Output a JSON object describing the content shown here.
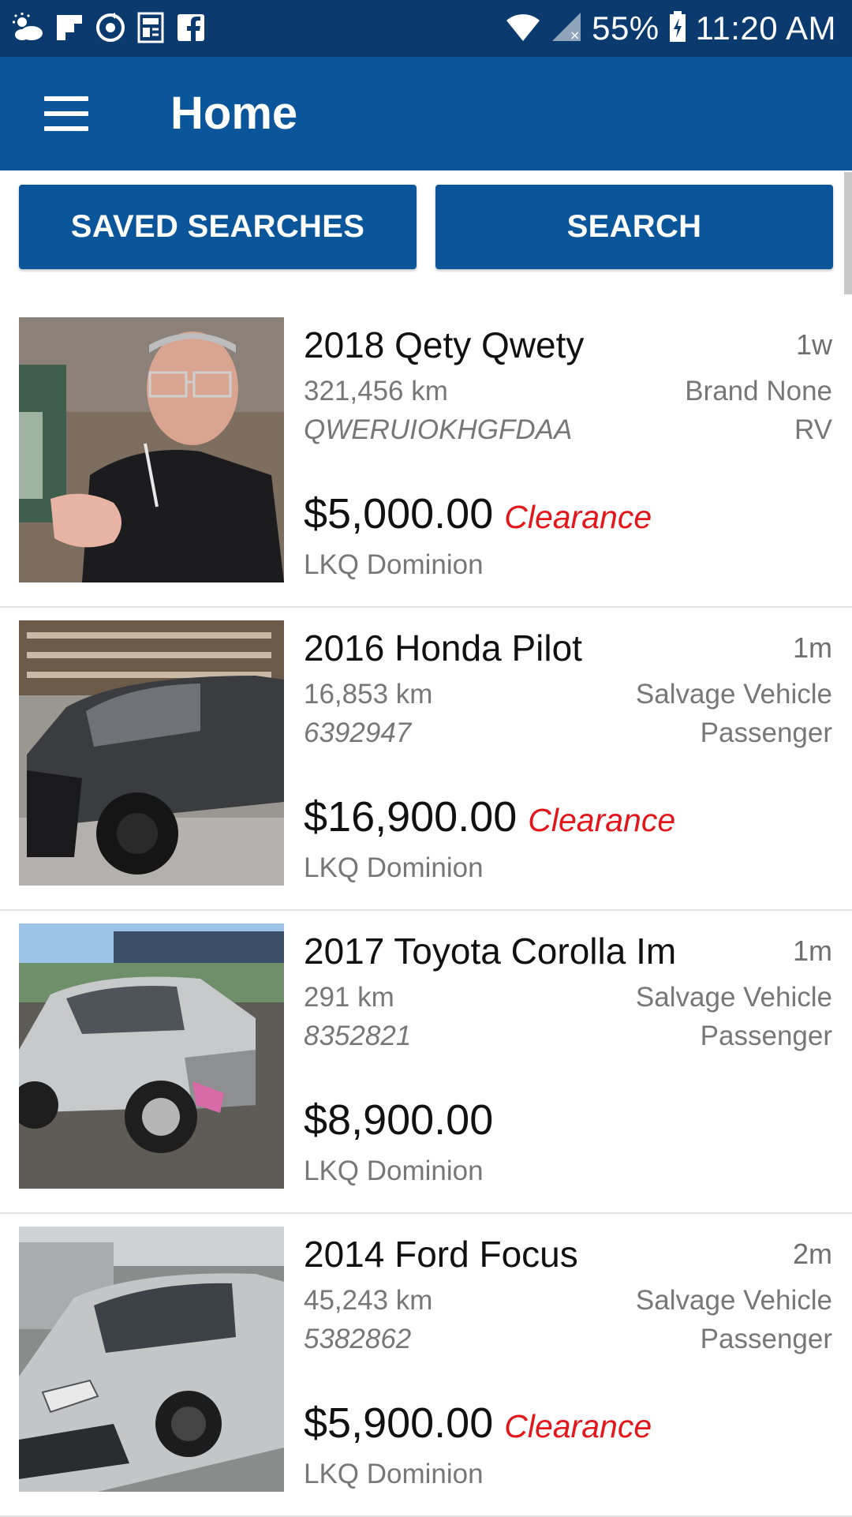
{
  "status_bar": {
    "battery": "55%",
    "time": "11:20 AM",
    "icons_left": [
      "weather-icon",
      "flipboard-icon",
      "sync-icon",
      "news-icon",
      "facebook-icon"
    ],
    "icons_right": [
      "wifi-icon",
      "signal-icon",
      "battery-icon"
    ]
  },
  "app_bar": {
    "title": "Home",
    "menu_icon": "hamburger-menu-icon"
  },
  "buttons": {
    "saved_searches": "SAVED SEARCHES",
    "search": "SEARCH"
  },
  "colors": {
    "primary": "#0b559b",
    "status_bar": "#0a3a6e",
    "clearance": "#e3161b"
  },
  "listings": [
    {
      "title": "2018 Qety Qwety",
      "age": "1w",
      "odometer": "321,456 km",
      "stock": "QWERUIOKHGFDAA",
      "condition": "Brand None",
      "vehicle_class": "RV",
      "price": "$5,000.00",
      "tag": "Clearance",
      "location": "LKQ Dominion",
      "photo": "person-photo"
    },
    {
      "title": "2016 Honda Pilot",
      "age": "1m",
      "odometer": "16,853 km",
      "stock": "6392947",
      "condition": "Salvage Vehicle",
      "vehicle_class": "Passenger",
      "price": "$16,900.00",
      "tag": "Clearance",
      "location": "LKQ Dominion",
      "photo": "dark-suv-photo"
    },
    {
      "title": "2017 Toyota Corolla Im",
      "age": "1m",
      "odometer": "291 km",
      "stock": "8352821",
      "condition": "Salvage Vehicle",
      "vehicle_class": "Passenger",
      "price": "$8,900.00",
      "tag": "",
      "location": "LKQ Dominion",
      "photo": "silver-hatchback-photo"
    },
    {
      "title": "2014 Ford Focus",
      "age": "2m",
      "odometer": "45,243 km",
      "stock": "5382862",
      "condition": "Salvage Vehicle",
      "vehicle_class": "Passenger",
      "price": "$5,900.00",
      "tag": "Clearance",
      "location": "LKQ Dominion",
      "photo": "silver-sedan-photo"
    }
  ]
}
